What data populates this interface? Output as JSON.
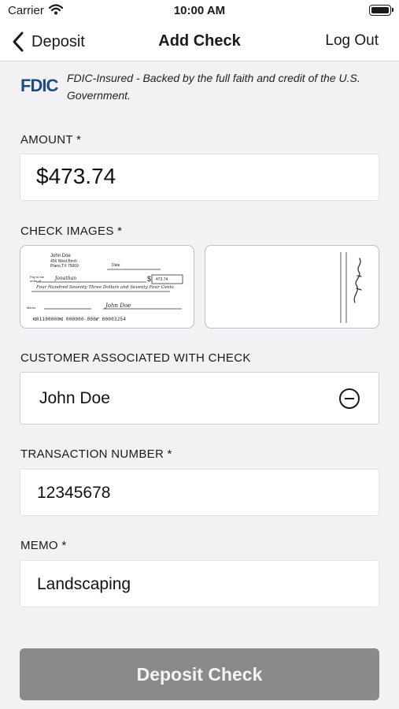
{
  "status_bar": {
    "carrier": "Carrier",
    "time": "10:00 AM"
  },
  "nav": {
    "back_label": "Deposit",
    "title": "Add Check",
    "logout_label": "Log Out"
  },
  "fdic": {
    "logo_text": "FDIC",
    "notice": "FDIC-Insured - Backed by the full faith and credit of the U.S. Government."
  },
  "amount": {
    "label": "AMOUNT *",
    "value": "$473.74"
  },
  "check_images": {
    "label": "CHECK IMAGES *",
    "front": {
      "payer_name": "John Doe",
      "payer_address1": "456 West Birch",
      "payer_address2": "Plano,TX 75669",
      "date_label": "Date",
      "pay_to_label": "Pay to the order of",
      "payee": "Jonathan",
      "amount_box": "473.74",
      "written_amount": "Four Hundred Seventy Three Dollars and Seventy Four Cents",
      "memo_label": "Memo",
      "signature": "John Doe",
      "micr": "⑆01100000⑆ 000000-000⑈ 00003254"
    }
  },
  "customer": {
    "label": "CUSTOMER ASSOCIATED WITH CHECK",
    "value": "John Doe"
  },
  "transaction": {
    "label": "TRANSACTION NUMBER *",
    "value": "12345678"
  },
  "memo": {
    "label": "MEMO *",
    "value": "Landscaping"
  },
  "submit": {
    "label": "Deposit Check"
  }
}
